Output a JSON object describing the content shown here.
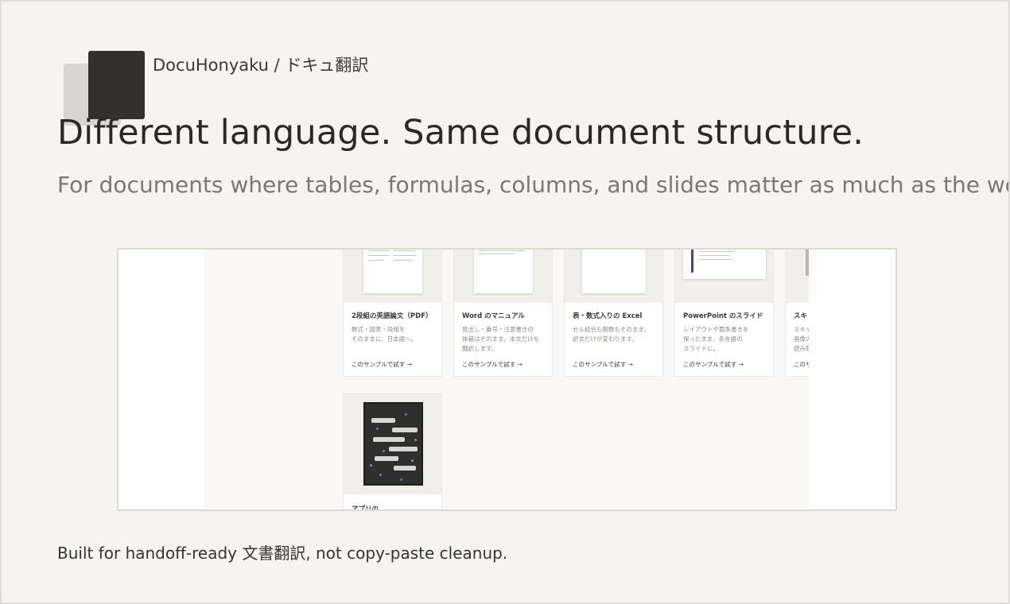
{
  "brand": {
    "name": "DocuHonyaku / ドキュ翻訳"
  },
  "hero": {
    "headline": "Different language. Same document structure.",
    "subline": "For documents where tables, formulas, columns, and slides matter as much as the wor"
  },
  "samples": [
    {
      "title": "2段組の英語論文（PDF）",
      "desc": "数式・図表・段組を\nそのままに、日本語へ。",
      "cta": "このサンプルで試す →"
    },
    {
      "title": "Word のマニュアル",
      "desc": "見出し・番号・注意書きの\n体裁はそのまま。本文だけを\n翻訳します。",
      "cta": "このサンプルで試す →"
    },
    {
      "title": "表・数式入りの Excel",
      "desc": "セル結合も関数もそのまま。\n訳文だけが変わります。",
      "cta": "このサンプルで試す →"
    },
    {
      "title": "PowerPoint のスライド",
      "desc": "レイアウトや箇条書きを\n保ったまま、多言語の\nスライドに。",
      "cta": "このサンプルで試す →"
    },
    {
      "title": "スキ",
      "desc": "スキャ\n画像の\n読み取",
      "cta": "このサ"
    },
    {
      "title": "アプリの",
      "desc": "",
      "cta": ""
    }
  ],
  "footer": {
    "text": "Built for handoff-ready 文書翻訳, not copy-paste cleanup."
  },
  "colors": {
    "background": "#f6f4f0",
    "logo": "#33312d",
    "accent": "#3d4d80"
  }
}
